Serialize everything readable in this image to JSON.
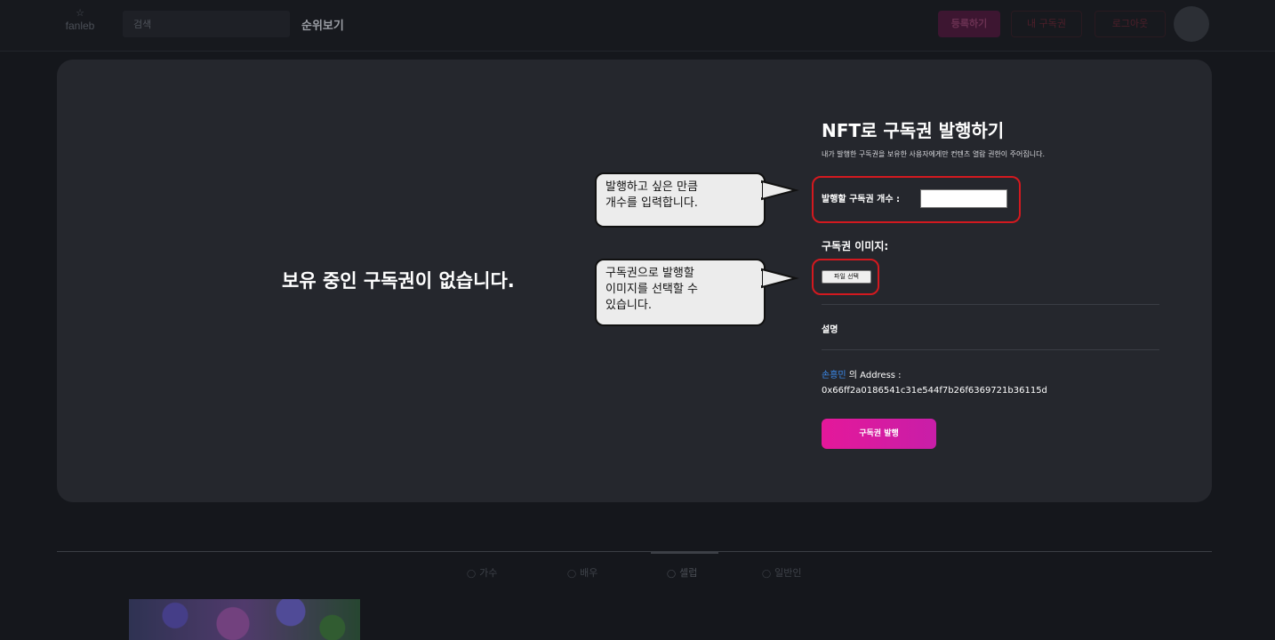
{
  "header": {
    "logo_text": "fanleb",
    "search_placeholder": "검색",
    "rank_link": "순위보기",
    "register_button": "등록하기",
    "button_2": "내 구독권",
    "button_3": "로그아웃"
  },
  "modal": {
    "empty_message": "보유 중인 구독권이 없습니다.",
    "title": "NFT로 구독권 발행하기",
    "subtitle": "내가 발행한 구독권을 보유한 사용자에게만 컨텐츠 열람 권한이 주어집니다.",
    "count_label": "발행할 구독권 개수 :",
    "count_value": "",
    "image_label": "구독권 이미지:",
    "file_button": "파일 선택",
    "description_label": "설명",
    "owner_name": "손흥민",
    "address_suffix": "의 Address :",
    "address_value": "0x66ff2a0186541c31e544f7b26f6369721b36115d",
    "issue_button": "구독권 발행",
    "callout_count": [
      "발행하고 싶은 만큼",
      "개수를 입력합니다."
    ],
    "callout_image": [
      "구독권으로 발행할",
      "이미지를 선택할 수",
      "있습니다."
    ]
  },
  "tabs": [
    {
      "label": "가수"
    },
    {
      "label": "배우"
    },
    {
      "label": "셀럽"
    },
    {
      "label": "일반인"
    }
  ],
  "colors": {
    "accent_pink": "#e4189a",
    "highlight_red": "#d3191f",
    "link_blue": "#3b8cf0"
  }
}
